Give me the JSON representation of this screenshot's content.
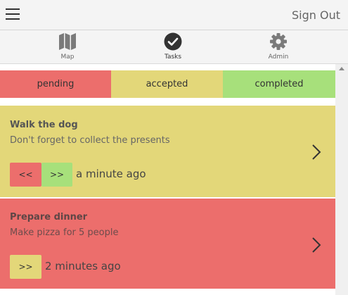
{
  "header": {
    "signout_label": "Sign Out"
  },
  "tabs": [
    {
      "label": "Map",
      "icon": "map-icon"
    },
    {
      "label": "Tasks",
      "icon": "check-circle-icon",
      "active": true
    },
    {
      "label": "Admin",
      "icon": "gear-icon"
    }
  ],
  "filters": [
    {
      "label": "pending",
      "color": "#ec6e6c"
    },
    {
      "label": "accepted",
      "color": "#e3d779"
    },
    {
      "label": "completed",
      "color": "#a7e07b"
    }
  ],
  "tasks": [
    {
      "title": "Walk the dog",
      "description": "Don't forget to collect the presents",
      "prev_label": "<<",
      "next_label": ">>",
      "time": "a minute ago",
      "status_color": "#e3d779"
    },
    {
      "title": "Prepare dinner",
      "description": "Make pizza for 5 people",
      "next_label": ">>",
      "time": "2 minutes ago",
      "status_color": "#ec6e6c"
    }
  ]
}
